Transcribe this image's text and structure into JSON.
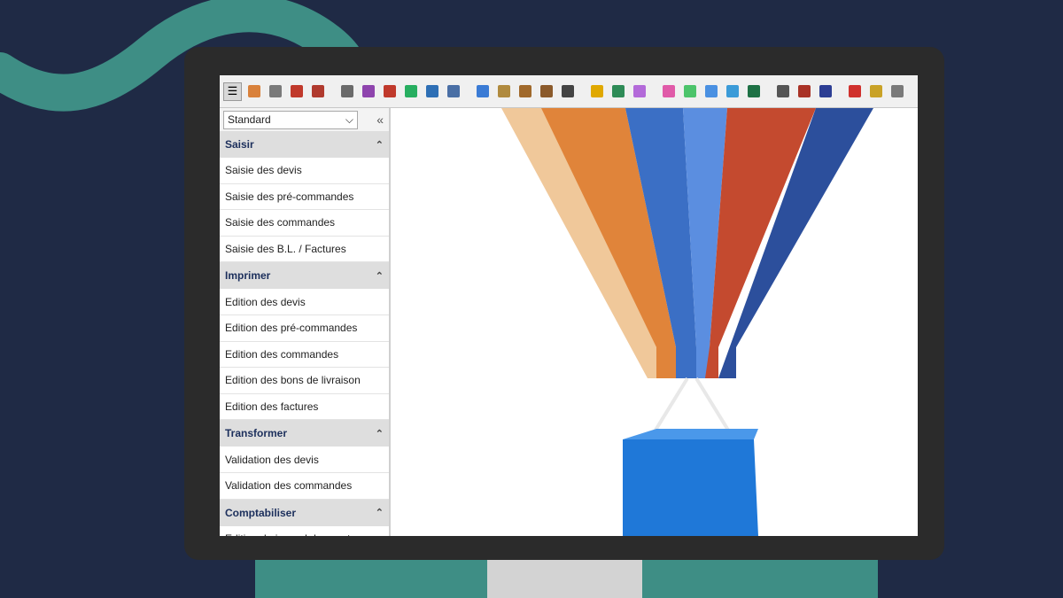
{
  "colors": {
    "background": "#1f2a45",
    "accent_teal": "#3e8e85",
    "stand_center": "#d3d3d3",
    "sidebar_header_text": "#1c2f5c"
  },
  "toolbar": {
    "icons": [
      "menu-icon",
      "user-icon",
      "building-icon",
      "house-icon",
      "car-icon",
      "book-icon",
      "doc-purple-icon",
      "doc-red-icon",
      "doc-green-icon",
      "doc-blue-icon",
      "doc-stack-icon",
      "bar-chart-icon",
      "money-bag-icon",
      "box-icon",
      "gear-box-icon",
      "cash-register-icon",
      "lock-icon",
      "bug-icon",
      "cube-purple-icon",
      "cube-pink-icon",
      "cube-green-icon",
      "cube-blue-icon",
      "picture-icon",
      "excel-icon",
      "network-icon",
      "book-red-icon",
      "book-blue-icon",
      "power-icon",
      "key-icon",
      "wrench-icon"
    ]
  },
  "sidebar": {
    "profile_select": "Standard",
    "sections": [
      {
        "title": "Saisir",
        "items": [
          "Saisie des devis",
          "Saisie des pré-commandes",
          "Saisie des commandes",
          "Saisie des B.L. / Factures"
        ]
      },
      {
        "title": "Imprimer",
        "items": [
          "Edition des devis",
          "Edition des pré-commandes",
          "Edition des commandes",
          "Edition des bons de livraison",
          "Edition des factures"
        ]
      },
      {
        "title": "Transformer",
        "items": [
          "Validation des devis",
          "Validation des commandes"
        ]
      },
      {
        "title": "Comptabiliser",
        "items": [
          "Edition du journal des ventes"
        ]
      }
    ]
  },
  "illustration": {
    "subject": "funnel-of-documents-lifting-box"
  }
}
